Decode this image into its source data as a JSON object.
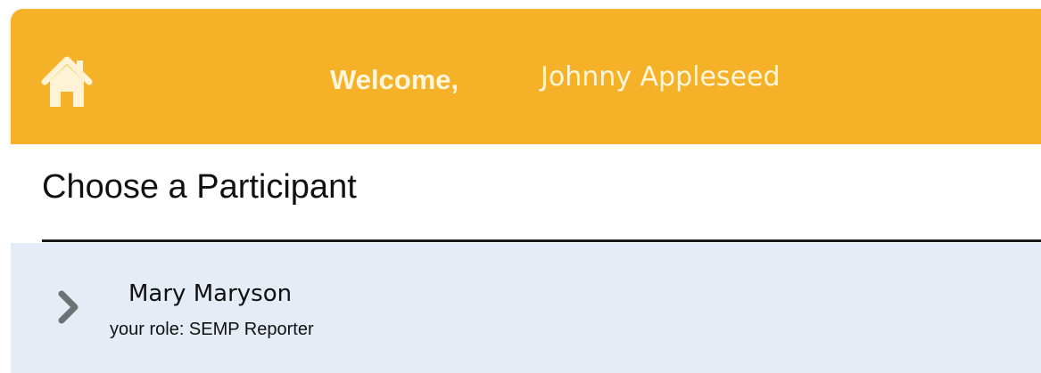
{
  "header": {
    "home_icon": "home-icon",
    "welcome_label": "Welcome,",
    "user_name": "Johnny Appleseed",
    "background_color": "#f5b128"
  },
  "main": {
    "title": "Choose a Participant",
    "participants": [
      {
        "name": "Mary Maryson",
        "role": "your role: SEMP Reporter",
        "icon": "chevron-right-icon",
        "row_color": "#e5ecf6"
      }
    ]
  }
}
